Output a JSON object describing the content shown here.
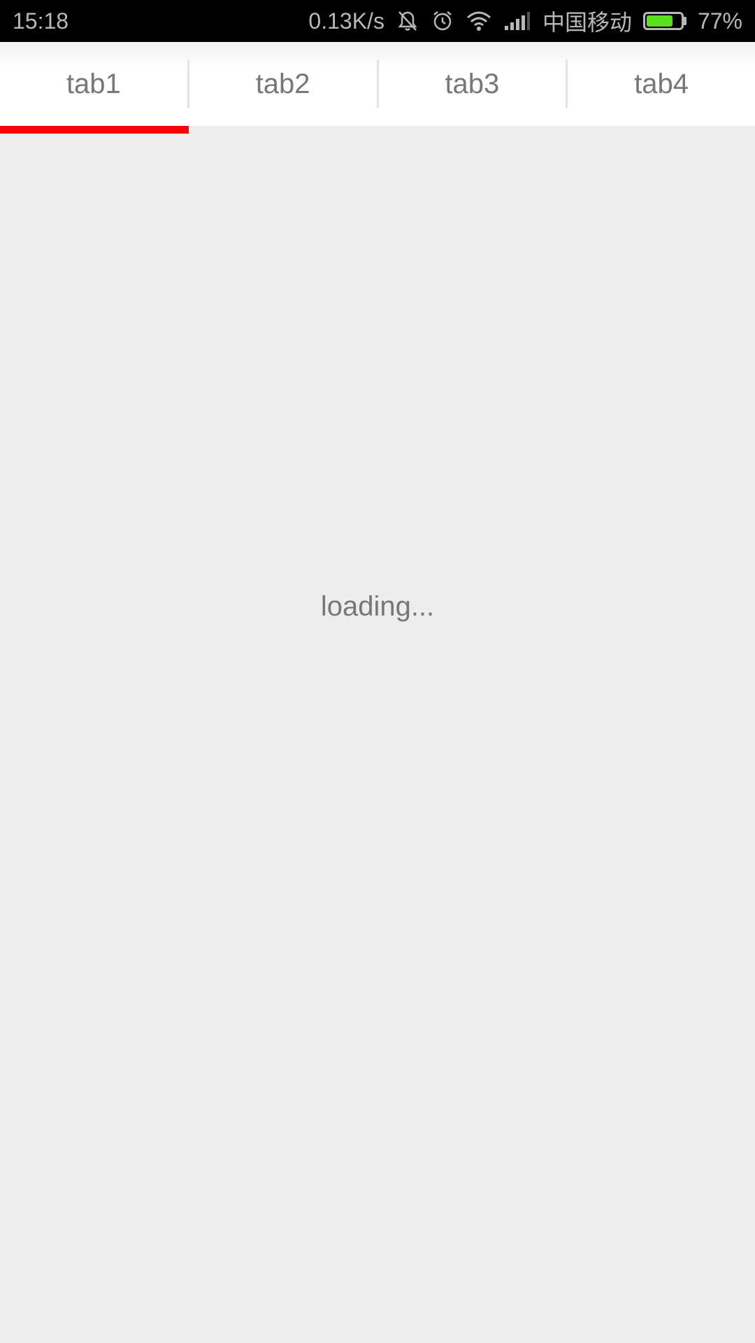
{
  "status_bar": {
    "time": "15:18",
    "network_speed": "0.13K/s",
    "carrier": "中国移动",
    "battery_percent": "77%",
    "battery_level": 0.77,
    "icons": [
      "mute-icon",
      "alarm-icon",
      "wifi-icon",
      "signal-icon",
      "battery-icon"
    ],
    "battery_color": "#5ce01b"
  },
  "tabs": [
    {
      "label": "tab1",
      "selected": true
    },
    {
      "label": "tab2",
      "selected": false
    },
    {
      "label": "tab3",
      "selected": false
    },
    {
      "label": "tab4",
      "selected": false
    }
  ],
  "accent_color": "#ff0000",
  "content": {
    "loading_text": "loading..."
  }
}
